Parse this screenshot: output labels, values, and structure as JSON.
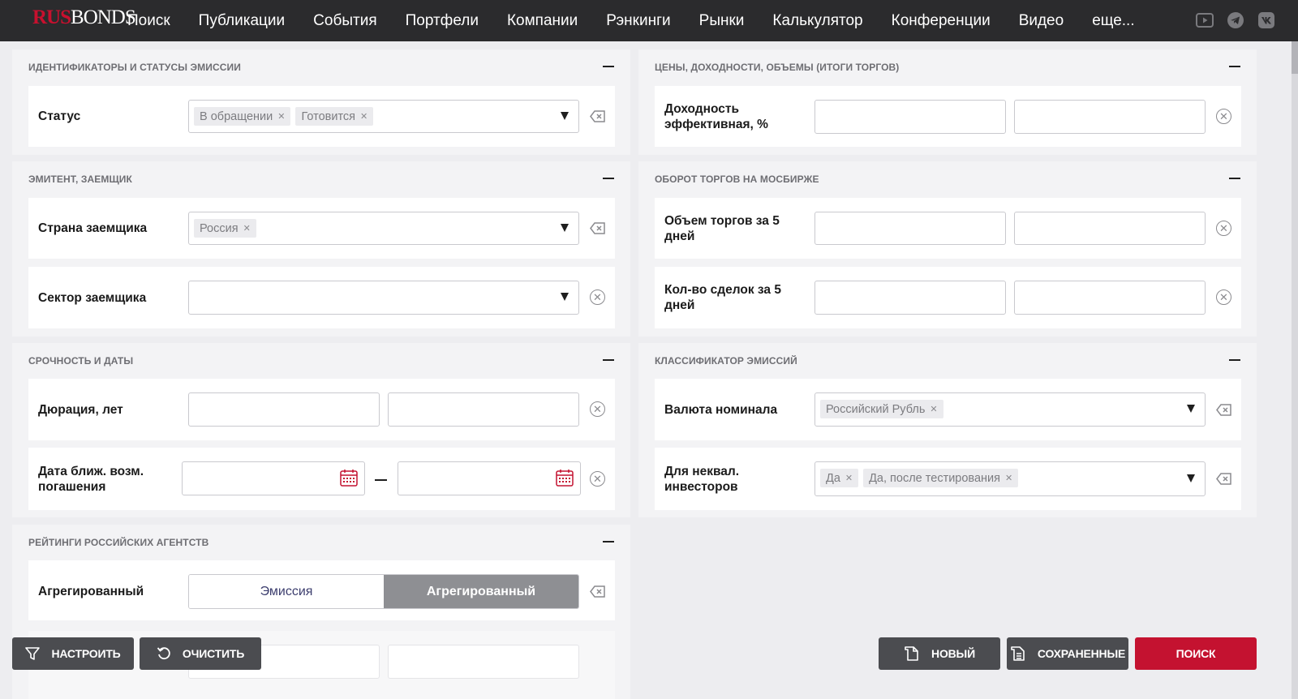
{
  "header": {
    "logo_rus": "RUS",
    "logo_bonds": "BONDS",
    "nav": [
      "Поиск",
      "Публикации",
      "События",
      "Портфели",
      "Компании",
      "Рэнкинги",
      "Рынки",
      "Калькулятор",
      "Конференции",
      "Видео",
      "еще..."
    ],
    "social_icons": [
      "youtube-icon",
      "telegram-icon",
      "vk-icon"
    ]
  },
  "sections": {
    "ids": {
      "title": "ИДЕНТИФИКАТОРЫ И СТАТУСЫ ЭМИССИИ",
      "status_label": "Статус",
      "status_tags": [
        "В обращении",
        "Готовится"
      ]
    },
    "issuer": {
      "title": "ЭМИТЕНТ, ЗАЕМЩИК",
      "country_label": "Страна заемщика",
      "country_tags": [
        "Россия"
      ],
      "sector_label": "Сектор заемщика"
    },
    "dates": {
      "title": "СРОЧНОСТЬ И ДАТЫ",
      "duration_label": "Дюрация, лет",
      "maturity_label_1": "Дата ближ. возм.",
      "maturity_label_2": "погашения"
    },
    "ratings": {
      "title": "РЕЙТИНГИ РОССИЙСКИХ АГЕНТСТВ",
      "aggregated_label": "Агрегированный",
      "options": [
        "Эмиссия",
        "Агрегированный"
      ],
      "selected": "Агрегированный"
    },
    "prices": {
      "title": "ЦЕНЫ, ДОХОДНОСТИ, ОБЪЕМЫ (ИТОГИ ТОРГОВ)",
      "yield_label_1": "Доходность",
      "yield_label_2": "эффективная, %"
    },
    "turnover": {
      "title": "ОБОРОТ ТОРГОВ НА МОСБИРЖЕ",
      "volume_label_1": "Объем торгов за 5",
      "volume_label_2": "дней",
      "deals_label_1": "Кол-во сделок за 5",
      "deals_label_2": "дней"
    },
    "classifier": {
      "title": "КЛАССИФИКАТОР ЭМИССИЙ",
      "currency_label": "Валюта номинала",
      "currency_tags": [
        "Российский Рубль"
      ],
      "qual_label_1": "Для неквал.",
      "qual_label_2": "инвесторов",
      "qual_tags": [
        "Да",
        "Да, после тестирования"
      ]
    }
  },
  "buttons": {
    "configure": "НАСТРОИТЬ",
    "clear": "ОЧИСТИТЬ",
    "new": "НОВЫЙ",
    "saved": "СОХРАНЕННЫЕ",
    "search": "ПОИСК"
  },
  "colors": {
    "brand_red": "#c41230",
    "nav_bg": "#2b2b2d",
    "button_dark": "#4b4c50"
  }
}
